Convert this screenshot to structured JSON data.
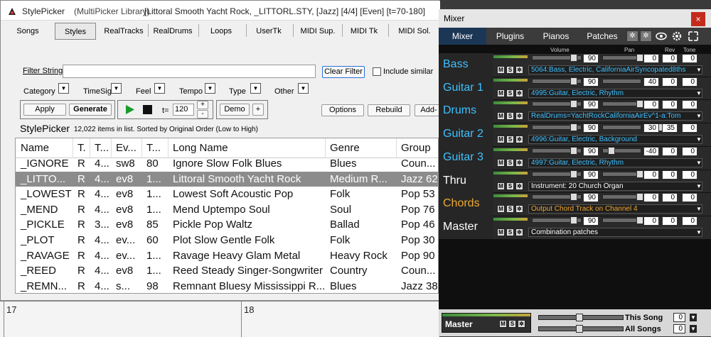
{
  "window": {
    "app_name": "StylePicker",
    "library": "(MultiPicker Library)",
    "style_info": "[Littoral Smooth Yacht Rock, _LITTORL.STY,  [Jazz] [4/4] [Even] [t=70-180]"
  },
  "tabs": [
    "Songs",
    "Styles",
    "RealTracks",
    "RealDrums",
    "Loops",
    "UserTk",
    "MIDI Sup.",
    "MIDI Tk",
    "MIDI Sol."
  ],
  "filter": {
    "label": "Filter String",
    "value": "",
    "clear_label": "Clear Filter",
    "include_similar_label": "Include similar"
  },
  "dropdowns": [
    "Category",
    "TimeSig",
    "Feel",
    "Tempo",
    "Type",
    "Other"
  ],
  "buttons": {
    "apply": "Apply",
    "generate": "Generate",
    "tempo_label": "t=",
    "tempo_value": "120",
    "plus": "+",
    "minus": "-",
    "demo": "Demo",
    "demo_plus": "+",
    "options": "Options",
    "rebuild": "Rebuild",
    "add": "Add-"
  },
  "list_info": {
    "title": "StylePicker",
    "count_text": "12,022 items in list. Sorted by Original Order  (Low to High)"
  },
  "table": {
    "headers": [
      "Name",
      "T.",
      "T...",
      "Ev...",
      "T...",
      "Long Name",
      "Genre",
      "Group"
    ],
    "rows": [
      [
        "_IGNORE",
        "R",
        "4...",
        "sw8",
        "80",
        "Ignore Slow Folk Blues",
        "Blues",
        "Coun..."
      ],
      [
        "_LITTO...",
        "R",
        "4...",
        "ev8",
        "1...",
        "Littoral Smooth Yacht Rock",
        "Medium R...",
        "Jazz 62"
      ],
      [
        "_LOWEST",
        "R",
        "4...",
        "ev8",
        "1...",
        "Lowest Soft Acoustic Pop",
        "Folk",
        "Pop 53"
      ],
      [
        "_MEND",
        "R",
        "4...",
        "ev8",
        "1...",
        "Mend Uptempo Soul",
        "Soul",
        "Pop 76"
      ],
      [
        "_PICKLE",
        "R",
        "3...",
        "ev8",
        "85",
        "Pickle Pop Waltz",
        "Ballad",
        "Pop 46"
      ],
      [
        "_PLOT",
        "R",
        "4...",
        "ev...",
        "60",
        "Plot Slow Gentle Folk",
        "Folk",
        "Pop 30"
      ],
      [
        "_RAVAGE",
        "R",
        "4...",
        "ev...",
        "1...",
        "Ravage Heavy Glam Metal",
        "Heavy Rock",
        "Pop 90"
      ],
      [
        "_REED",
        "R",
        "4...",
        "ev8",
        "1...",
        "Reed Steady Singer-Songwriter",
        "Country",
        "Coun..."
      ],
      [
        "_REMN...",
        "R",
        "4...",
        "s...",
        "98",
        "Remnant Bluesy Mississippi R...",
        "Blues",
        "Jazz 38"
      ]
    ],
    "selected_row": 1
  },
  "timeline": {
    "bar_left": "17",
    "bar_right": "18"
  },
  "mixer": {
    "title": "Mixer",
    "close": "×",
    "tabs": [
      "Mixer",
      "Plugins",
      "Pianos",
      "Patches"
    ],
    "columns": {
      "volume": "Volume",
      "pan": "Pan",
      "rev": "Rev",
      "tone": "Tone"
    },
    "m_label": "M",
    "s_label": "S",
    "tracks": [
      {
        "name": "Bass",
        "color": "#3fc0ff",
        "volume": "90",
        "pan": "0",
        "rev": "0",
        "tone": "0",
        "patch": "5064:Bass, Electric, CaliforniaAirSyncopated8ths",
        "patch_color": "#3fc0ff"
      },
      {
        "name": "Guitar 1",
        "color": "#3fc0ff",
        "volume": "90",
        "pan": "40",
        "rev": "0",
        "tone": "0",
        "patch": "4995:Guitar, Electric, Rhythm",
        "patch_color": "#3fc0ff"
      },
      {
        "name": "Drums",
        "color": "#3fc0ff",
        "volume": "90",
        "pan": "0",
        "rev": "0",
        "tone": "0",
        "patch": "RealDrums=YachtRockCaliforniaAirEv^1-a:Tom",
        "patch_color": "#3fc0ff"
      },
      {
        "name": "Guitar 2",
        "color": "#3fc0ff",
        "volume": "90",
        "pan": "30",
        "rev": "35",
        "tone": "0",
        "patch": "4996:Guitar, Electric, Background",
        "patch_color": "#3fc0ff"
      },
      {
        "name": "Guitar 3",
        "color": "#3fc0ff",
        "volume": "90",
        "pan": "-40",
        "rev": "0",
        "tone": "0",
        "patch": "4997:Guitar, Electric, Rhythm",
        "patch_color": "#3fc0ff"
      },
      {
        "name": "Thru",
        "color": "#ffffff",
        "volume": "90",
        "pan": "0",
        "rev": "0",
        "tone": "0",
        "patch": "Instrument: 20 Church Organ",
        "patch_color": "#ffffff"
      },
      {
        "name": "Chords",
        "color": "#f0a830",
        "volume": "90",
        "pan": "0",
        "rev": "0",
        "tone": "0",
        "patch": "Output Chord Track on Channel 4",
        "patch_color": "#f0a830"
      },
      {
        "name": "Master",
        "color": "#ffffff",
        "volume": "90",
        "pan": "0",
        "rev": "0",
        "tone": "0",
        "patch": "Combination patches",
        "patch_color": "#ffffff"
      }
    ],
    "master": {
      "label": "Master",
      "this_song": "This Song",
      "this_song_value": "0",
      "all_songs": "All Songs",
      "all_songs_value": "0"
    }
  }
}
